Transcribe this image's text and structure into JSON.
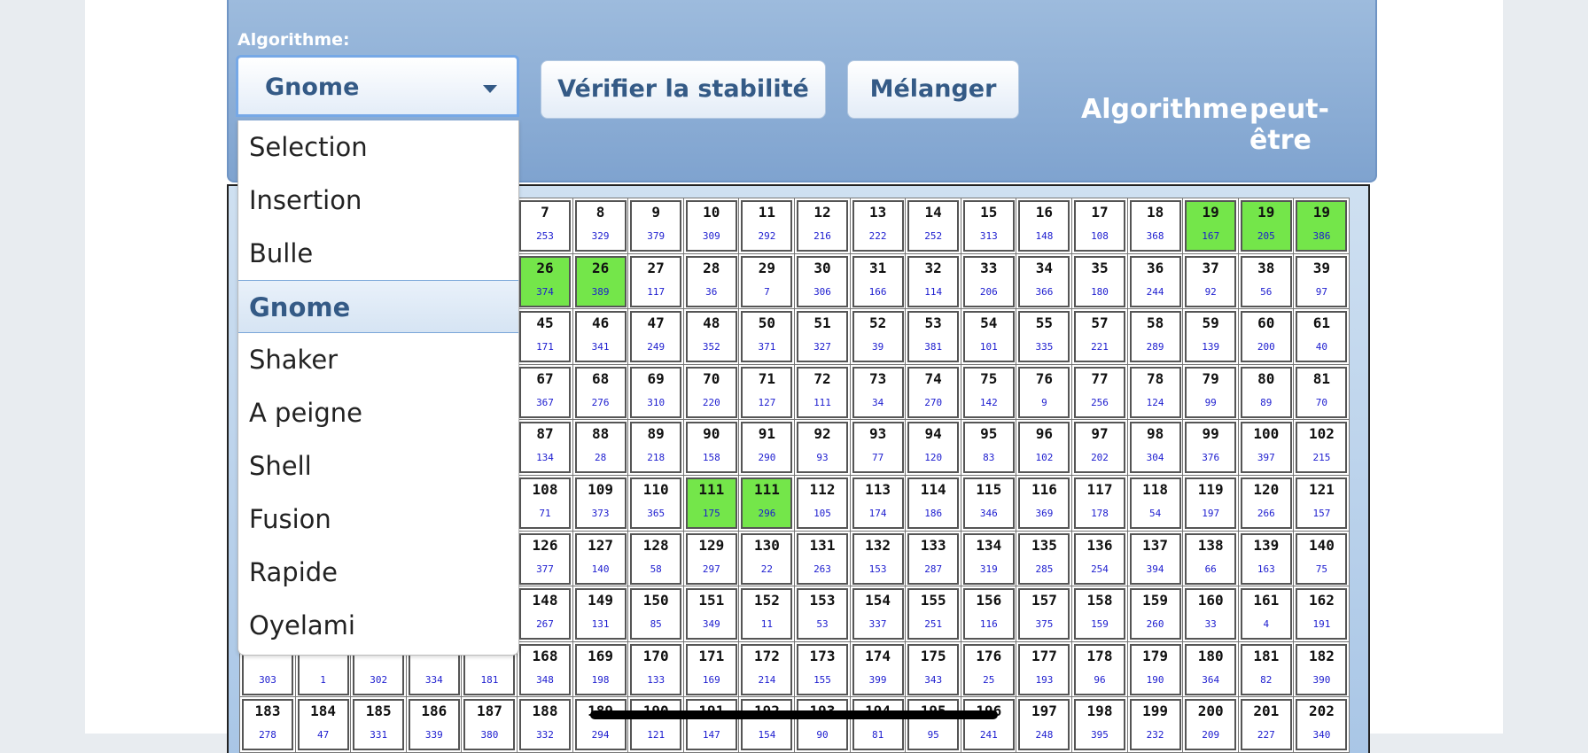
{
  "toolbar": {
    "algo_label": "Algorithme:",
    "selected": "Gnome",
    "verify_label": "Vérifier la stabilité",
    "shuffle_label": "Mélanger",
    "status_word1": "Algorithme",
    "status_word2": "peut-être"
  },
  "dropdown": {
    "options": [
      "Selection",
      "Insertion",
      "Bulle",
      "Gnome",
      "Shaker",
      "A peigne",
      "Shell",
      "Fusion",
      "Rapide",
      "Oyelami"
    ],
    "selected_index": 3
  },
  "colors": {
    "highlight": "#74e64a",
    "value": "#1c1ccf",
    "accent": "#345a86"
  },
  "grid": {
    "rows": [
      [
        {
          "k": "7",
          "v": "253"
        },
        {
          "k": "8",
          "v": "329"
        },
        {
          "k": "9",
          "v": "379"
        },
        {
          "k": "10",
          "v": "309"
        },
        {
          "k": "11",
          "v": "292"
        },
        {
          "k": "12",
          "v": "216"
        },
        {
          "k": "13",
          "v": "222"
        },
        {
          "k": "14",
          "v": "252"
        },
        {
          "k": "15",
          "v": "313"
        },
        {
          "k": "16",
          "v": "148"
        },
        {
          "k": "17",
          "v": "108"
        },
        {
          "k": "18",
          "v": "368"
        },
        {
          "k": "19",
          "v": "167",
          "h": true
        },
        {
          "k": "19",
          "v": "205",
          "h": true
        },
        {
          "k": "19",
          "v": "386",
          "h": true
        }
      ],
      [
        {
          "k": "26",
          "v": "374",
          "h": true
        },
        {
          "k": "26",
          "v": "389",
          "h": true
        },
        {
          "k": "27",
          "v": "117"
        },
        {
          "k": "28",
          "v": "36"
        },
        {
          "k": "29",
          "v": "7"
        },
        {
          "k": "30",
          "v": "306"
        },
        {
          "k": "31",
          "v": "166"
        },
        {
          "k": "32",
          "v": "114"
        },
        {
          "k": "33",
          "v": "206"
        },
        {
          "k": "34",
          "v": "366"
        },
        {
          "k": "35",
          "v": "180"
        },
        {
          "k": "36",
          "v": "244"
        },
        {
          "k": "37",
          "v": "92"
        },
        {
          "k": "38",
          "v": "56"
        },
        {
          "k": "39",
          "v": "97"
        }
      ],
      [
        {
          "k": "45",
          "v": "171"
        },
        {
          "k": "46",
          "v": "341"
        },
        {
          "k": "47",
          "v": "249"
        },
        {
          "k": "48",
          "v": "352"
        },
        {
          "k": "50",
          "v": "371"
        },
        {
          "k": "51",
          "v": "327"
        },
        {
          "k": "52",
          "v": "39"
        },
        {
          "k": "53",
          "v": "381"
        },
        {
          "k": "54",
          "v": "101"
        },
        {
          "k": "55",
          "v": "335"
        },
        {
          "k": "57",
          "v": "221"
        },
        {
          "k": "58",
          "v": "289"
        },
        {
          "k": "59",
          "v": "139"
        },
        {
          "k": "60",
          "v": "200"
        },
        {
          "k": "61",
          "v": "40"
        }
      ],
      [
        {
          "k": "67",
          "v": "367"
        },
        {
          "k": "68",
          "v": "276"
        },
        {
          "k": "69",
          "v": "310"
        },
        {
          "k": "70",
          "v": "220"
        },
        {
          "k": "71",
          "v": "127"
        },
        {
          "k": "72",
          "v": "111"
        },
        {
          "k": "73",
          "v": "34"
        },
        {
          "k": "74",
          "v": "270"
        },
        {
          "k": "75",
          "v": "142"
        },
        {
          "k": "76",
          "v": "9"
        },
        {
          "k": "77",
          "v": "256"
        },
        {
          "k": "78",
          "v": "124"
        },
        {
          "k": "79",
          "v": "99"
        },
        {
          "k": "80",
          "v": "89"
        },
        {
          "k": "81",
          "v": "70"
        }
      ],
      [
        {
          "k": "87",
          "v": "134"
        },
        {
          "k": "88",
          "v": "28"
        },
        {
          "k": "89",
          "v": "218"
        },
        {
          "k": "90",
          "v": "158"
        },
        {
          "k": "91",
          "v": "290"
        },
        {
          "k": "92",
          "v": "93"
        },
        {
          "k": "93",
          "v": "77"
        },
        {
          "k": "94",
          "v": "120"
        },
        {
          "k": "95",
          "v": "83"
        },
        {
          "k": "96",
          "v": "102"
        },
        {
          "k": "97",
          "v": "202"
        },
        {
          "k": "98",
          "v": "304"
        },
        {
          "k": "99",
          "v": "376"
        },
        {
          "k": "100",
          "v": "397"
        },
        {
          "k": "102",
          "v": "215"
        }
      ],
      [
        {
          "k": "108",
          "v": "71"
        },
        {
          "k": "109",
          "v": "373"
        },
        {
          "k": "110",
          "v": "365"
        },
        {
          "k": "111",
          "v": "175",
          "h": true
        },
        {
          "k": "111",
          "v": "296",
          "h": true
        },
        {
          "k": "112",
          "v": "105"
        },
        {
          "k": "113",
          "v": "174"
        },
        {
          "k": "114",
          "v": "186"
        },
        {
          "k": "115",
          "v": "346"
        },
        {
          "k": "116",
          "v": "369"
        },
        {
          "k": "117",
          "v": "178"
        },
        {
          "k": "118",
          "v": "54"
        },
        {
          "k": "119",
          "v": "197"
        },
        {
          "k": "120",
          "v": "266"
        },
        {
          "k": "121",
          "v": "157"
        }
      ],
      [
        {
          "k": "126",
          "v": "377"
        },
        {
          "k": "127",
          "v": "140"
        },
        {
          "k": "128",
          "v": "58"
        },
        {
          "k": "129",
          "v": "297"
        },
        {
          "k": "130",
          "v": "22"
        },
        {
          "k": "131",
          "v": "263"
        },
        {
          "k": "132",
          "v": "153"
        },
        {
          "k": "133",
          "v": "287"
        },
        {
          "k": "134",
          "v": "319"
        },
        {
          "k": "135",
          "v": "285"
        },
        {
          "k": "136",
          "v": "254"
        },
        {
          "k": "137",
          "v": "394"
        },
        {
          "k": "138",
          "v": "66"
        },
        {
          "k": "139",
          "v": "163"
        },
        {
          "k": "140",
          "v": "75"
        }
      ],
      [
        {
          "k": "148",
          "v": "267"
        },
        {
          "k": "149",
          "v": "131"
        },
        {
          "k": "150",
          "v": "85"
        },
        {
          "k": "151",
          "v": "349"
        },
        {
          "k": "152",
          "v": "11"
        },
        {
          "k": "153",
          "v": "53"
        },
        {
          "k": "154",
          "v": "337"
        },
        {
          "k": "155",
          "v": "251"
        },
        {
          "k": "156",
          "v": "116"
        },
        {
          "k": "157",
          "v": "375"
        },
        {
          "k": "158",
          "v": "159"
        },
        {
          "k": "159",
          "v": "260"
        },
        {
          "k": "160",
          "v": "33"
        },
        {
          "k": "161",
          "v": "4"
        },
        {
          "k": "162",
          "v": "191"
        }
      ],
      [
        {
          "k": "",
          "v": "303"
        },
        {
          "k": "",
          "v": "1"
        },
        {
          "k": "",
          "v": "302"
        },
        {
          "k": "",
          "v": "334"
        },
        {
          "k": "",
          "v": "181"
        },
        {
          "k": "168",
          "v": "348"
        },
        {
          "k": "169",
          "v": "198"
        },
        {
          "k": "170",
          "v": "133"
        },
        {
          "k": "171",
          "v": "169"
        },
        {
          "k": "172",
          "v": "214"
        },
        {
          "k": "173",
          "v": "155"
        },
        {
          "k": "174",
          "v": "399"
        },
        {
          "k": "175",
          "v": "343"
        },
        {
          "k": "176",
          "v": "25"
        },
        {
          "k": "177",
          "v": "193"
        },
        {
          "k": "178",
          "v": "96"
        },
        {
          "k": "179",
          "v": "190"
        },
        {
          "k": "180",
          "v": "364"
        },
        {
          "k": "181",
          "v": "82"
        },
        {
          "k": "182",
          "v": "390"
        }
      ],
      [
        {
          "k": "183",
          "v": "278"
        },
        {
          "k": "184",
          "v": "47"
        },
        {
          "k": "185",
          "v": "331"
        },
        {
          "k": "186",
          "v": "339"
        },
        {
          "k": "187",
          "v": "380"
        },
        {
          "k": "188",
          "v": "332"
        },
        {
          "k": "189",
          "v": "294"
        },
        {
          "k": "190",
          "v": "121"
        },
        {
          "k": "191",
          "v": "147"
        },
        {
          "k": "192",
          "v": "154"
        },
        {
          "k": "193",
          "v": "90"
        },
        {
          "k": "194",
          "v": "81"
        },
        {
          "k": "195",
          "v": "95"
        },
        {
          "k": "196",
          "v": "241"
        },
        {
          "k": "197",
          "v": "248"
        },
        {
          "k": "198",
          "v": "395"
        },
        {
          "k": "199",
          "v": "232"
        },
        {
          "k": "200",
          "v": "209"
        },
        {
          "k": "201",
          "v": "227"
        },
        {
          "k": "202",
          "v": "340"
        }
      ]
    ]
  }
}
